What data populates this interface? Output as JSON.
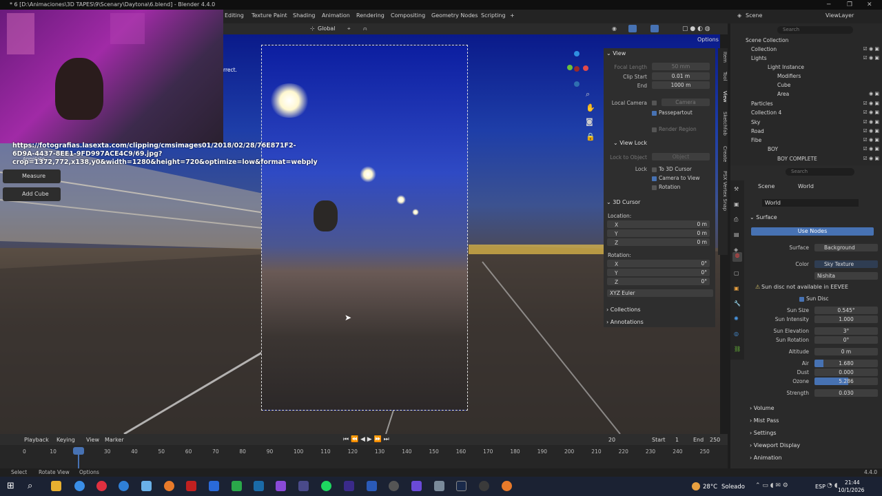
{
  "window": {
    "title": "* 6 [D:\\Animaciones\\3D TAPES\\9\\Scenary\\Daytona\\6.blend] - Blender 4.4.0",
    "minimize": "─",
    "maximize": "❐",
    "close": "✕"
  },
  "workspaces": [
    "Editing",
    "Texture Paint",
    "Shading",
    "Animation",
    "Rendering",
    "Compositing",
    "Geometry Nodes",
    "Scripting",
    "+"
  ],
  "top_right": {
    "scene_label": "Scene",
    "viewlayer_label": "ViewLayer"
  },
  "header": {
    "orientation": "Global",
    "options": "Options"
  },
  "viewport": {
    "overlay_text": "rrect.",
    "url_text": "https://fotografias.lasexta.com/clipping/cmsimages01/2018/02/28/76E871F2-6D9A-4437-8EE1-9FD997ACE4C9/69.jpg?crop=1372,772,x138,y0&width=1280&height=720&optimize=low&format=webply"
  },
  "tools": {
    "annotate": "Annotate",
    "measure": "Measure",
    "add_cube": "Add Cube"
  },
  "npanel": {
    "view_title": "View",
    "focal_length_label": "Focal Length",
    "focal_length": "50 mm",
    "clip_start_label": "Clip Start",
    "clip_start": "0.01 m",
    "end_label": "End",
    "end": "1000 m",
    "local_camera_label": "Local Camera",
    "camera_field": "Camera",
    "passepartout": "Passepartout",
    "render_region": "Render Region",
    "view_lock_title": "View Lock",
    "lock_to_object_label": "Lock to Object",
    "object_field": "Object",
    "lock_label": "Lock",
    "to_3d_cursor": "To 3D Cursor",
    "camera_to_view": "Camera to View",
    "rotation_chk": "Rotation",
    "cursor_title": "3D Cursor",
    "location_label": "Location:",
    "x": "X",
    "y": "Y",
    "z": "Z",
    "loc_x": "0 m",
    "loc_y": "0 m",
    "loc_z": "0 m",
    "rotation_label": "Rotation:",
    "rot_x": "0°",
    "rot_y": "0°",
    "rot_z": "0°",
    "rot_mode": "XYZ Euler",
    "collections": "Collections",
    "annotations": "Annotations"
  },
  "ntabs": [
    "Item",
    "Tool",
    "View",
    "Sketchfab",
    "Create",
    "PSX Vertex Snap"
  ],
  "outliner": {
    "search_placeholder": "Search",
    "items": [
      "Scene Collection",
      "Collection",
      "Lights",
      "Light Instance",
      "Modifiers",
      "Cube",
      "Area",
      "Particles",
      "Collection 4",
      "Sky",
      "Road",
      "Fibe",
      "BOY",
      "BOY COMPLETE"
    ]
  },
  "properties": {
    "search_placeholder": "Search",
    "breadcrumb_scene": "Scene",
    "breadcrumb_world": "World",
    "world_name": "World",
    "surface_title": "Surface",
    "use_nodes": "Use Nodes",
    "surface_label": "Surface",
    "surface_value": "Background",
    "color_label": "Color",
    "color_value": "Sky Texture",
    "sky_type": "Nishita",
    "sun_warning": "Sun disc not available in EEVEE",
    "sun_disc": "Sun Disc",
    "sun_size_label": "Sun Size",
    "sun_size": "0.545°",
    "sun_intensity_label": "Sun Intensity",
    "sun_intensity": "1.000",
    "sun_elevation_label": "Sun Elevation",
    "sun_elevation": "3°",
    "sun_rotation_label": "Sun Rotation",
    "sun_rotation": "0°",
    "altitude_label": "Altitude",
    "altitude": "0 m",
    "air_label": "Air",
    "air": "1.680",
    "dust_label": "Dust",
    "dust": "0.000",
    "ozone_label": "Ozone",
    "ozone": "5.286",
    "strength_label": "Strength",
    "strength": "0.030",
    "volume": "Volume",
    "mist_pass": "Mist Pass",
    "settings": "Settings",
    "viewport_display": "Viewport Display",
    "animation": "Animation"
  },
  "timeline": {
    "playback": "Playback",
    "keying": "Keying",
    "view": "View",
    "marker": "Marker",
    "current_frame": "20",
    "start_label": "Start",
    "start": "1",
    "end_label": "End",
    "end": "250",
    "ticks": [
      "0",
      "10",
      "20",
      "30",
      "40",
      "50",
      "60",
      "70",
      "80",
      "90",
      "100",
      "110",
      "120",
      "130",
      "140",
      "150",
      "160",
      "170",
      "180",
      "190",
      "200",
      "210",
      "220",
      "230",
      "240",
      "250"
    ]
  },
  "statusbar": {
    "select": "Select",
    "rotate_view": "Rotate View",
    "options": "Options",
    "version": "4.4.0"
  },
  "taskbar": {
    "weather_temp": "28°C",
    "weather_desc": "Soleado",
    "lang": "ESP",
    "time": "21:44",
    "date": "10/1/2026"
  },
  "colors": {
    "accent": "#4772b3",
    "header": "#2b2b2b",
    "panel": "#2e2e2e"
  }
}
